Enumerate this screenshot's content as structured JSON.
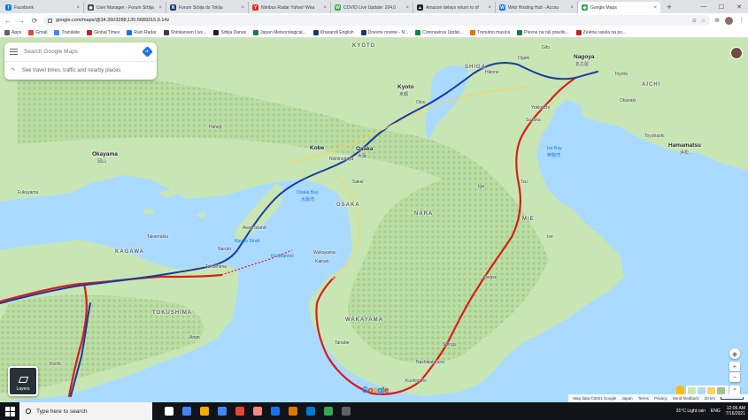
{
  "tabs": [
    {
      "title": "Facebook",
      "color": "#1877f2",
      "glyph": "f"
    },
    {
      "title": "User Manager - Forum Srbija",
      "color": "#3c4043",
      "glyph": "◉"
    },
    {
      "title": "Forum Srbija do Tokija",
      "color": "#1a3a6b",
      "glyph": "N"
    },
    {
      "title": "Nimbus Radar Yahoo! Wea",
      "color": "#d93025",
      "glyph": "Y"
    },
    {
      "title": "COVID Live Update: 204,0",
      "color": "#34a853",
      "glyph": "W"
    },
    {
      "title": "Amazon delays return to of",
      "color": "#202124",
      "glyph": "▲"
    },
    {
      "title": "Web Hosting Hub - Accou",
      "color": "#1a73e8",
      "glyph": "W"
    },
    {
      "title": "Google Maps",
      "color": "#34a853",
      "glyph": "◆",
      "active": true
    }
  ],
  "window_controls": {
    "minimize": "—",
    "maximize": "☐",
    "close": "✕"
  },
  "toolbar": {
    "back": "←",
    "forward": "→",
    "reload": "⟳",
    "url": "google.com/maps/@34.3603288,135.5689315,9.14z",
    "omni_icons": [
      "⊙",
      "☆"
    ],
    "right_icons": [
      "⊕",
      "⋮"
    ]
  },
  "bookmarks": [
    {
      "label": "Apps",
      "color": "#5f6368"
    },
    {
      "label": "Gmail",
      "color": "#ea4335"
    },
    {
      "label": "Translate",
      "color": "#4285f4"
    },
    {
      "label": "Global Times",
      "color": "#c5221f"
    },
    {
      "label": "Rain Radar",
      "color": "#1a73e8"
    },
    {
      "label": "Shinkansen Live...",
      "color": "#3c4043"
    },
    {
      "label": "Srbija Danas",
      "color": "#202124"
    },
    {
      "label": "Japan Meteorological...",
      "color": "#188038"
    },
    {
      "label": "Kharandi English",
      "color": "#1a3a6b"
    },
    {
      "label": "Dnevne novine - N...",
      "color": "#1a3a6b"
    },
    {
      "label": "Coronavirus Updat...",
      "color": "#188038"
    },
    {
      "label": "Trenutno musica",
      "color": "#e37400"
    },
    {
      "label": "Plesne na ruli pravilo...",
      "color": "#188038"
    },
    {
      "label": "Zelena rasela na po...",
      "color": "#c5221f"
    }
  ],
  "search": {
    "placeholder": "Search Google Maps",
    "hint": "See travel times, traffic and nearby places"
  },
  "labels": {
    "kyoto_region": "KYOTO",
    "shiga": "SHIGA",
    "aichi": "AICHI",
    "nagoya": "Nagoya",
    "nagoya_jp": "名古屋",
    "kyoto": "Kyoto",
    "kyoto_jp": "京都",
    "kobe": "Kobe",
    "osaka": "Osaka",
    "osaka_jp": "大阪",
    "osaka_region": "OSAKA",
    "nara": "NARA",
    "mie": "MIE",
    "okayama": "Okayama",
    "okayama_jp": "岡山",
    "kagawa": "KAGAWA",
    "tokushima": "TOKUSHIMA",
    "wakayama": "WAKAYAMA",
    "hamamatsu": "Hamamatsu",
    "hamamatsu_jp": "浜松",
    "toyota": "Toyota",
    "himeji": "Himeji",
    "awaji": "Awaji Island",
    "osaka_bay": "Osaka Bay",
    "osaka_bay_jp": "大阪湾",
    "ise_bay": "Ise Bay",
    "ise_bay_jp": "伊勢湾",
    "kii": "Kii Channel",
    "wakayama_city": "Wakayama",
    "naruto": "Naruto",
    "tokushima_city": "Tokushima",
    "takamatsu": "Takamatsu",
    "tsu": "Tsu",
    "kainan": "Kainan",
    "kochi": "Kochi",
    "nachikatsuura": "Nachikatsuura",
    "fukuyama": "Fukuyama",
    "iga": "Iga",
    "ise": "Ise",
    "gifu": "Gifu",
    "ogaki": "Ogaki",
    "hikone": "Hikone",
    "otsu": "Otsu",
    "nishinomiya": "Nishinomiya",
    "sakai": "Sakai",
    "tanabe": "Tanabe",
    "shingu": "Shingu",
    "kushimoto": "Kushimoto",
    "owase": "Owase",
    "suzuka": "Suzuka",
    "yokkaichi": "Yokkaichi",
    "toyohashi": "Toyohashi",
    "okazaki": "Okazaki",
    "anan": "Anan",
    "naruto_strait": "Naruto Strait"
  },
  "layers_label": "Layers",
  "controls": {
    "compass": "◈",
    "zoom_in": "+",
    "zoom_out": "−",
    "expand": "⌃"
  },
  "google": [
    "G",
    "o",
    "o",
    "g",
    "l",
    "e"
  ],
  "footer": {
    "attrib": "Map data ©2021 Google",
    "japan": "Japan",
    "terms": "Terms",
    "privacy": "Privacy",
    "feedback": "Send feedback",
    "scale": "20 km"
  },
  "taskbar": {
    "search_placeholder": "Type here to search",
    "weather": "31°C  Light rain",
    "lang": "ENG",
    "time": "12:06 AM",
    "date": "7/16/2021",
    "app_colors": [
      "#ffffff",
      "#4285f4",
      "#f9ab00",
      "#4285f4",
      "#ea4335",
      "#f28b82",
      "#1a73e8",
      "#e37400",
      "#0078d4",
      "#34a853",
      "#5f6368"
    ]
  },
  "colors": {
    "route_blue": "#1a3aa6",
    "route_red": "#d91e18",
    "land": "#c8e6b3",
    "mountain": "#9fc68a",
    "water": "#aadaff"
  }
}
